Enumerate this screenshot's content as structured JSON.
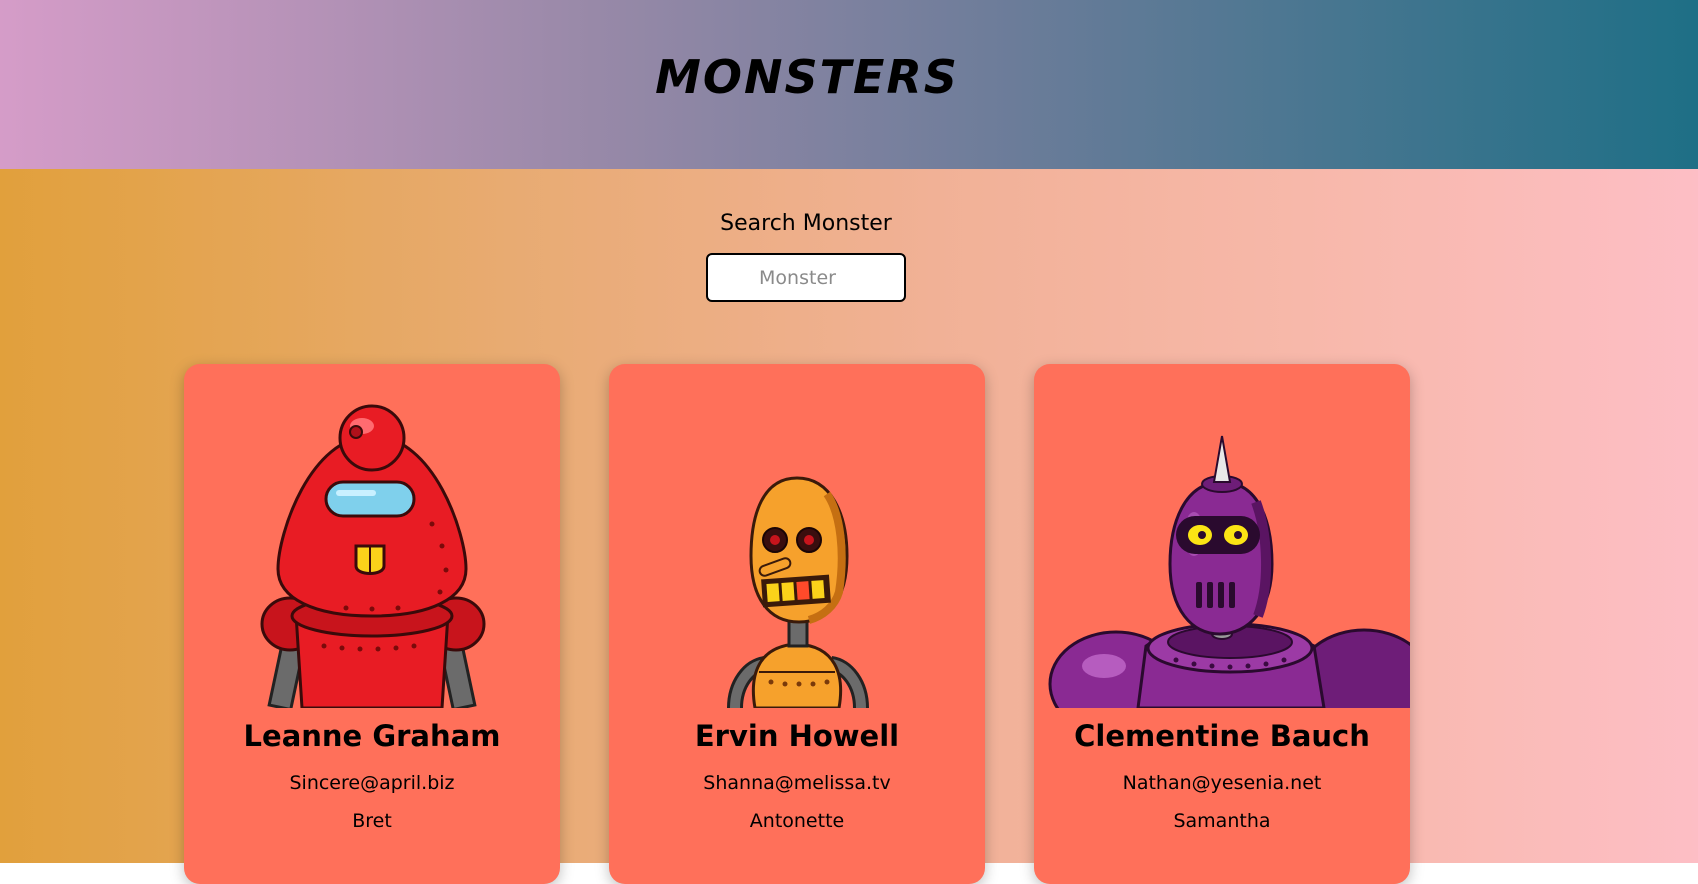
{
  "header": {
    "title": "MONSTERS"
  },
  "search": {
    "label": "Search Monster",
    "placeholder": "Monster",
    "value": ""
  },
  "monsters": [
    {
      "name": "Leanne Graham",
      "email": "Sincere@april.biz",
      "username": "Bret",
      "robot_color": "#e81c24",
      "robot_icon": "red-robot-icon"
    },
    {
      "name": "Ervin Howell",
      "email": "Shanna@melissa.tv",
      "username": "Antonette",
      "robot_color": "#f6a12c",
      "robot_icon": "orange-robot-icon"
    },
    {
      "name": "Clementine Bauch",
      "email": "Nathan@yesenia.net",
      "username": "Samantha",
      "robot_color": "#8a2a93",
      "robot_icon": "purple-robot-icon"
    }
  ],
  "colors": {
    "card_bg": "#ff705a",
    "header_start": "#d59cc8",
    "header_end": "#1e6f86",
    "body_start": "#e1a03c",
    "body_end": "#fdbec5"
  }
}
